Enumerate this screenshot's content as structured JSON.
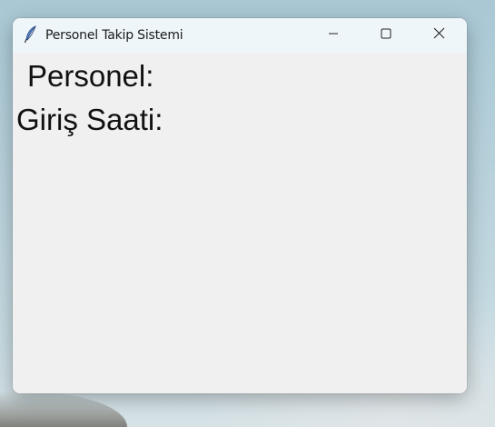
{
  "window": {
    "title": "Personel Takip Sistemi",
    "app_icon": "feather-icon",
    "controls": {
      "minimize_icon": "minimize-icon",
      "maximize_icon": "maximize-icon",
      "close_icon": "close-icon"
    }
  },
  "content": {
    "personel_label": "Personel:",
    "giris_label": "Giriş Saati:"
  }
}
